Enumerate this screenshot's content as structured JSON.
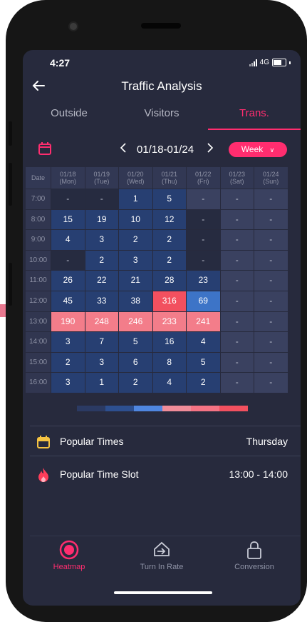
{
  "status": {
    "time": "4:27",
    "network": "4G"
  },
  "header": {
    "title": "Traffic Analysis"
  },
  "tabs": [
    {
      "label": "Outside",
      "active": false
    },
    {
      "label": "Visitors",
      "active": false
    },
    {
      "label": "Trans.",
      "active": true
    }
  ],
  "date_range": {
    "label": "01/18-01/24",
    "period": "Week"
  },
  "table": {
    "corner": "Date",
    "days": [
      {
        "date": "01/18",
        "dow": "(Mon)"
      },
      {
        "date": "01/19",
        "dow": "(Tue)"
      },
      {
        "date": "01/20",
        "dow": "(Wed)"
      },
      {
        "date": "01/21",
        "dow": "(Thu)"
      },
      {
        "date": "01/22",
        "dow": "(Fri)"
      },
      {
        "date": "01/23",
        "dow": "(Sat)"
      },
      {
        "date": "01/24",
        "dow": "(Sun)"
      }
    ],
    "rows": [
      {
        "time": "7:00",
        "values": [
          "-",
          "-",
          "1",
          "5",
          "-",
          "-",
          "-"
        ]
      },
      {
        "time": "8:00",
        "values": [
          "15",
          "19",
          "10",
          "12",
          "-",
          "-",
          "-"
        ]
      },
      {
        "time": "9:00",
        "values": [
          "4",
          "3",
          "2",
          "2",
          "-",
          "-",
          "-"
        ]
      },
      {
        "time": "10:00",
        "values": [
          "-",
          "2",
          "3",
          "2",
          "-",
          "-",
          "-"
        ]
      },
      {
        "time": "11:00",
        "values": [
          "26",
          "22",
          "21",
          "28",
          "23",
          "-",
          "-"
        ]
      },
      {
        "time": "12:00",
        "values": [
          "45",
          "33",
          "38",
          "316",
          "69",
          "-",
          "-"
        ]
      },
      {
        "time": "13:00",
        "values": [
          "190",
          "248",
          "246",
          "233",
          "241",
          "-",
          "-"
        ]
      },
      {
        "time": "14:00",
        "values": [
          "3",
          "7",
          "5",
          "16",
          "4",
          "-",
          "-"
        ]
      },
      {
        "time": "15:00",
        "values": [
          "2",
          "3",
          "6",
          "8",
          "5",
          "-",
          "-"
        ]
      },
      {
        "time": "16:00",
        "values": [
          "3",
          "1",
          "2",
          "4",
          "2",
          "-",
          "-"
        ]
      }
    ]
  },
  "colors": {
    "accent": "#ff2d6f",
    "screen_bg": "#272a3d",
    "empty_cell": "#3a4160",
    "dark_cell": "#262b40",
    "low": "#273f72",
    "mid": "#3d74c7",
    "high": "#f37d8a",
    "peak": "#f2505f"
  },
  "legend_colors": [
    "#2b3a63",
    "#2d4f8f",
    "#4f86e0",
    "#f08c99",
    "#f57384",
    "#f2505f"
  ],
  "popular_times": {
    "label": "Popular Times",
    "value": "Thursday",
    "icon": "calendar-icon"
  },
  "popular_slot": {
    "label": "Popular Time Slot",
    "value": "13:00 - 14:00",
    "icon": "fire-icon"
  },
  "nav": [
    {
      "label": "Heatmap",
      "icon": "heatmap-icon",
      "active": true
    },
    {
      "label": "Turn In Rate",
      "icon": "turn-in-icon",
      "active": false
    },
    {
      "label": "Conversion",
      "icon": "lock-icon",
      "active": false
    }
  ]
}
